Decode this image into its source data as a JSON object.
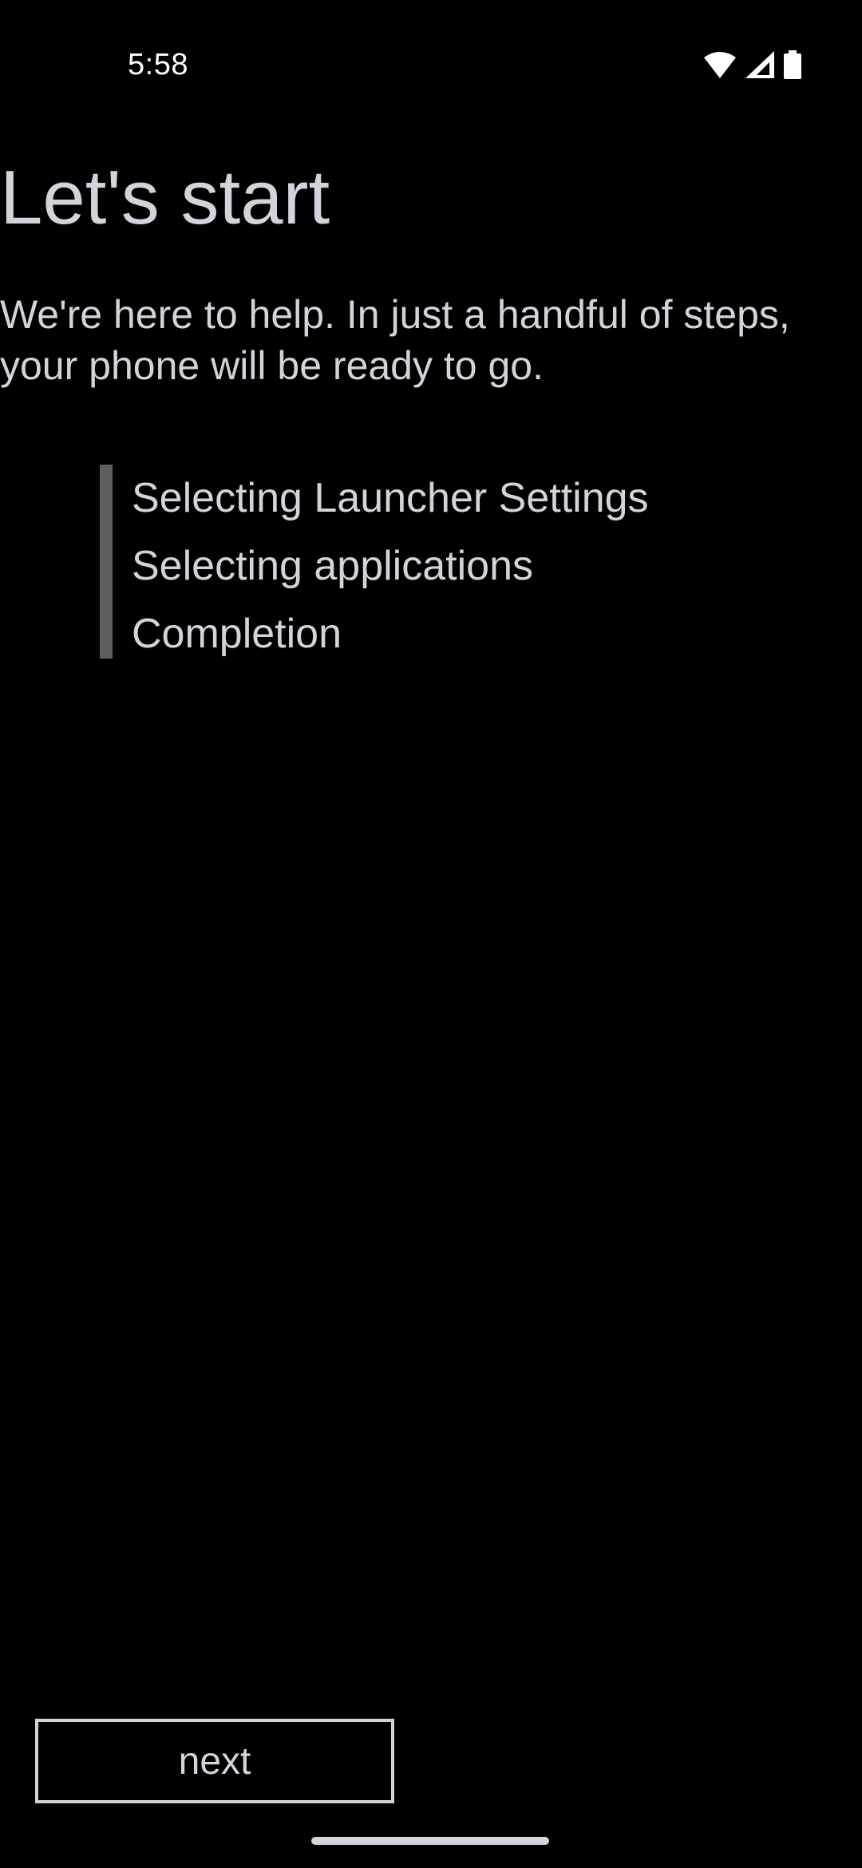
{
  "status_bar": {
    "time": "5:58",
    "icons": [
      "wifi-icon",
      "cell-signal-icon",
      "battery-icon"
    ]
  },
  "main": {
    "title": "Let's start",
    "intro": "We're here to help. In just a handful of steps, your phone will be ready to go.",
    "steps": [
      "Selecting Launcher Settings",
      "Selecting applications",
      "Completion"
    ]
  },
  "footer": {
    "next_label": "next"
  },
  "colors": {
    "background": "#000000",
    "text": "#d6d2db",
    "step_bar": "#5e5e5e"
  }
}
